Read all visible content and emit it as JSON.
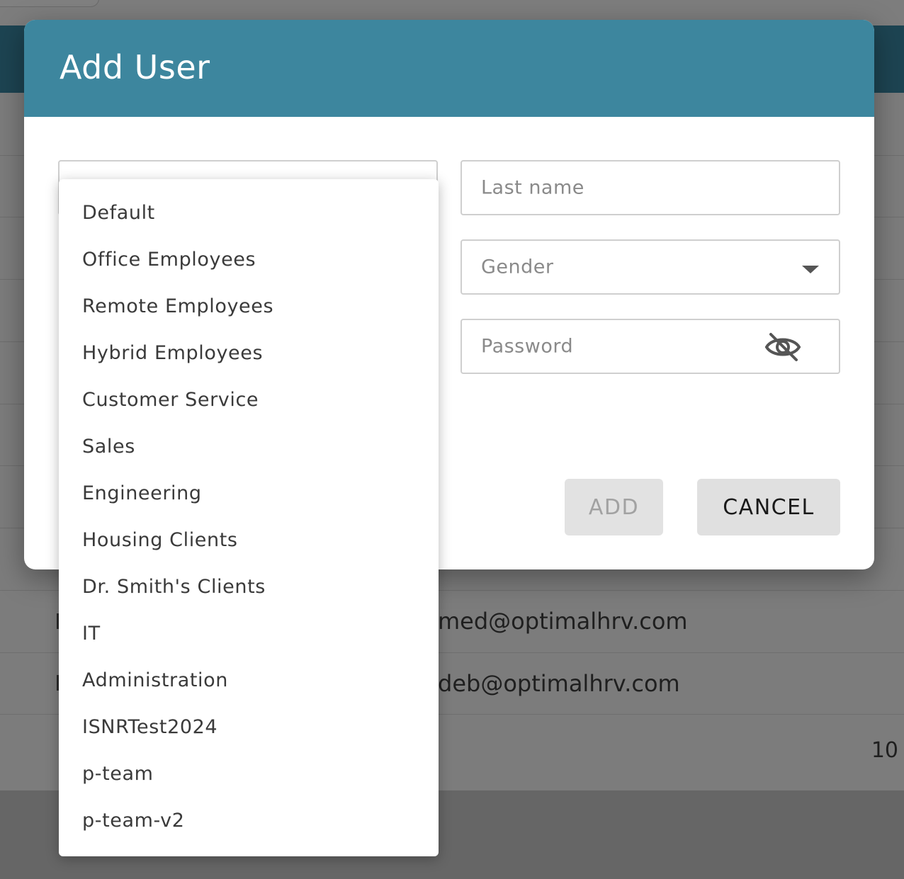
{
  "modal": {
    "title": "Add User",
    "last_name_placeholder": "Last name",
    "gender_placeholder": "Gender",
    "password_placeholder": "Password",
    "add_label": "ADD",
    "cancel_label": "CANCEL"
  },
  "dropdown": {
    "items": [
      "Default",
      "Office Employees",
      "Remote Employees",
      "Hybrid Employees",
      "Customer Service",
      "Sales",
      "Engineering",
      "Housing Clients",
      "Dr. Smith's Clients",
      "IT",
      "Administration",
      "ISNRTest2024",
      "p-team",
      "p-team-v2"
    ]
  },
  "background": {
    "email_1": "med@optimalhrv.com",
    "email_2": "deb@optimalhrv.com",
    "count": "10"
  },
  "colors": {
    "header": "#3d869e",
    "add_disabled_bg": "#e2e2e2",
    "cancel_bg": "#e0e0e0"
  },
  "icons": {
    "password_toggle": "eye-off-icon",
    "gender_caret": "chevron-down-icon"
  }
}
